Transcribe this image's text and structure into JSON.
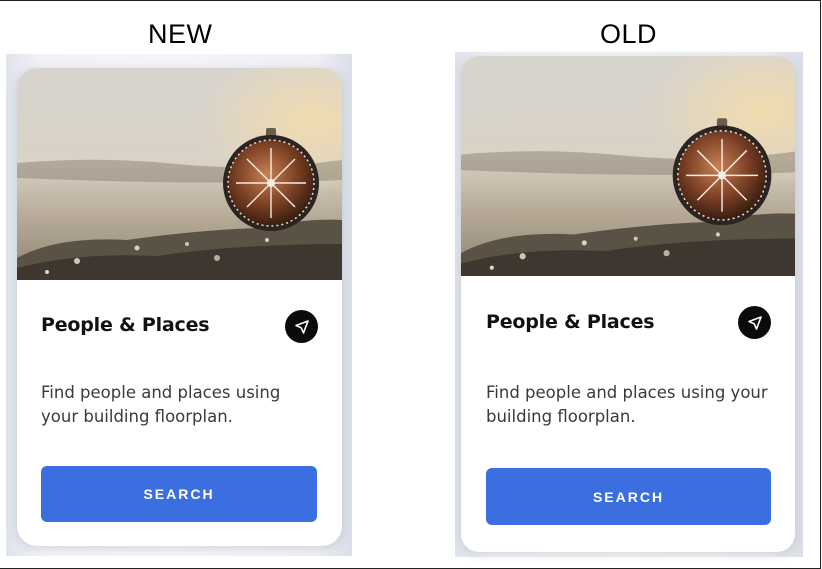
{
  "labels": {
    "new": "NEW",
    "old": "OLD"
  },
  "card": {
    "title": "People & Places",
    "description_line1": "Find people and places using",
    "description_line2": "your building floorplan.",
    "description_old_line1": "Find people and places using your",
    "description_old_line2": "building floorplan.",
    "button_label": "SEARCH",
    "icon": "navigation-arrow-icon",
    "image": "compass-on-rock-photo"
  },
  "colors": {
    "button": "#3b6fe0",
    "icon_bg": "#0b0b0b",
    "title": "#111111"
  }
}
